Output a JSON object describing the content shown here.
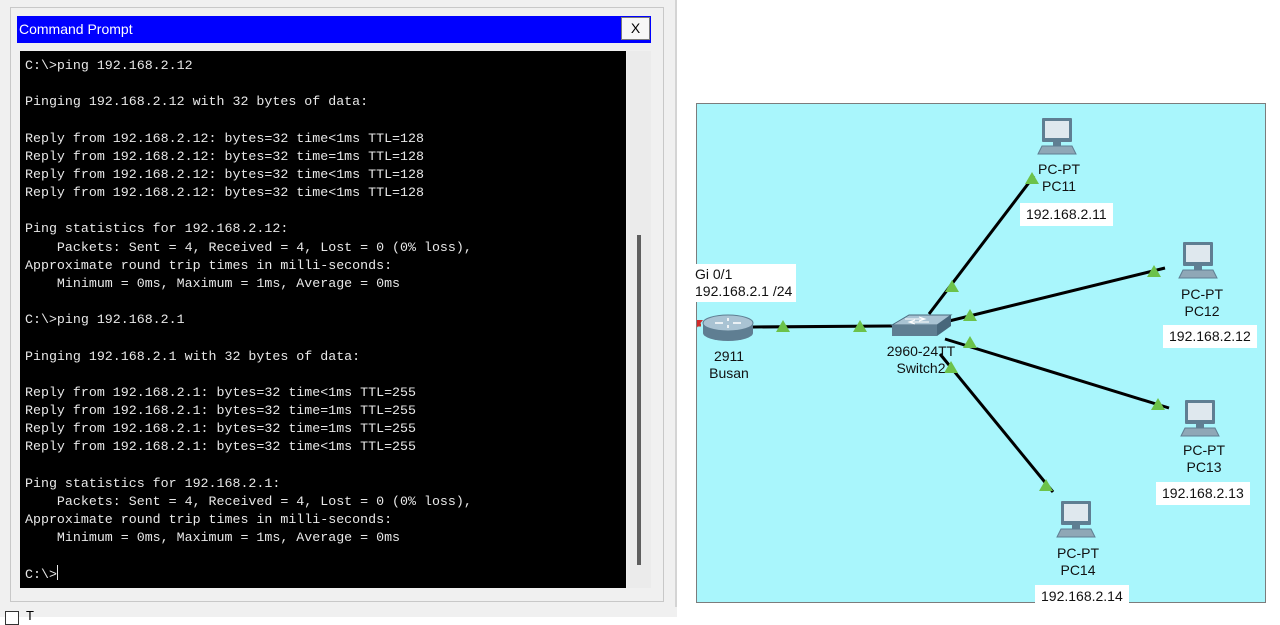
{
  "command_prompt": {
    "title": "Command Prompt",
    "close_label": "X",
    "lines": [
      "C:\\>ping 192.168.2.12",
      "",
      "Pinging 192.168.2.12 with 32 bytes of data:",
      "",
      "Reply from 192.168.2.12: bytes=32 time<1ms TTL=128",
      "Reply from 192.168.2.12: bytes=32 time=1ms TTL=128",
      "Reply from 192.168.2.12: bytes=32 time<1ms TTL=128",
      "Reply from 192.168.2.12: bytes=32 time<1ms TTL=128",
      "",
      "Ping statistics for 192.168.2.12:",
      "    Packets: Sent = 4, Received = 4, Lost = 0 (0% loss),",
      "Approximate round trip times in milli-seconds:",
      "    Minimum = 0ms, Maximum = 1ms, Average = 0ms",
      "",
      "C:\\>ping 192.168.2.1",
      "",
      "Pinging 192.168.2.1 with 32 bytes of data:",
      "",
      "Reply from 192.168.2.1: bytes=32 time<1ms TTL=255",
      "Reply from 192.168.2.1: bytes=32 time=1ms TTL=255",
      "Reply from 192.168.2.1: bytes=32 time=1ms TTL=255",
      "Reply from 192.168.2.1: bytes=32 time<1ms TTL=255",
      "",
      "Ping statistics for 192.168.2.1:",
      "    Packets: Sent = 4, Received = 4, Lost = 0 (0% loss),",
      "Approximate round trip times in milli-seconds:",
      "    Minimum = 0ms, Maximum = 1ms, Average = 0ms",
      "",
      "C:\\>"
    ]
  },
  "bottom_checkbox_label": "T",
  "topology": {
    "background_color": "#a9f6fc",
    "link_status_color": "#6cc24a",
    "router": {
      "interface_label": "Gi 0/1",
      "interface_ip": "192.168.2.1 /24",
      "model": "2911",
      "name": "Busan"
    },
    "switch": {
      "model": "2960-24TT",
      "name": "Switch2"
    },
    "pcs": [
      {
        "type": "PC-PT",
        "name": "PC11",
        "ip": "192.168.2.11"
      },
      {
        "type": "PC-PT",
        "name": "PC12",
        "ip": "192.168.2.12"
      },
      {
        "type": "PC-PT",
        "name": "PC13",
        "ip": "192.168.2.13"
      },
      {
        "type": "PC-PT",
        "name": "PC14",
        "ip": "192.168.2.14"
      }
    ]
  }
}
